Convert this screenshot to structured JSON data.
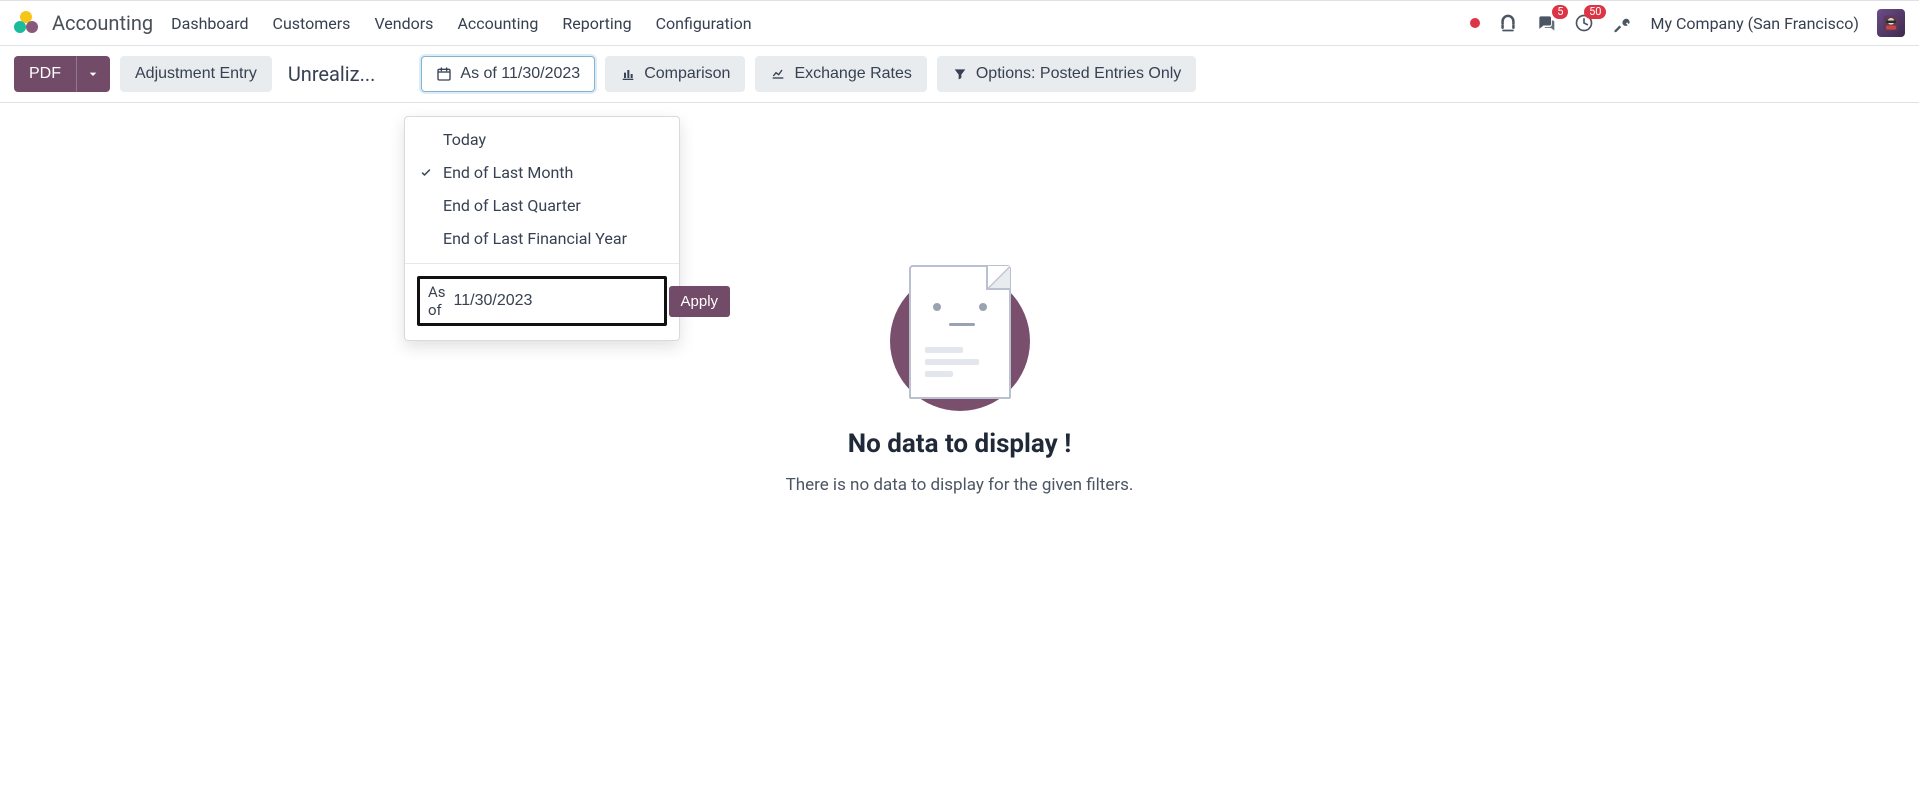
{
  "app": {
    "name": "Accounting"
  },
  "nav": {
    "items": [
      {
        "label": "Dashboard"
      },
      {
        "label": "Customers"
      },
      {
        "label": "Vendors"
      },
      {
        "label": "Accounting"
      },
      {
        "label": "Reporting"
      },
      {
        "label": "Configuration"
      }
    ]
  },
  "header_right": {
    "messages_badge": "5",
    "activities_badge": "50",
    "company": "My Company (San Francisco)"
  },
  "toolbar": {
    "pdf_label": "PDF",
    "adjustment_entry_label": "Adjustment Entry",
    "breadcrumb_truncated": "Unrealiz...",
    "as_of_button_label": "As of 11/30/2023",
    "comparison_label": "Comparison",
    "exchange_rates_label": "Exchange Rates",
    "options_label": "Options: Posted Entries Only"
  },
  "date_dropdown": {
    "options": [
      {
        "label": "Today",
        "selected": false
      },
      {
        "label": "End of Last Month",
        "selected": true
      },
      {
        "label": "End of Last Quarter",
        "selected": false
      },
      {
        "label": "End of Last Financial Year",
        "selected": false
      }
    ],
    "as_of_label": "As of",
    "as_of_value": "11/30/2023",
    "apply_label": "Apply"
  },
  "empty_state": {
    "title": "No data to display !",
    "subtitle": "There is no data to display for the given filters."
  }
}
